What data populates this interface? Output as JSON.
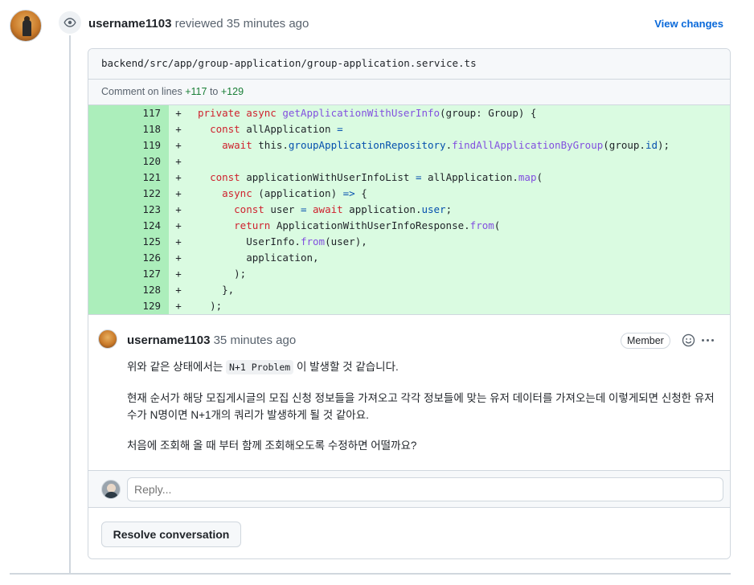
{
  "review": {
    "username": "username1103",
    "action": "reviewed",
    "time": "35 minutes ago",
    "view_changes_label": "View changes"
  },
  "file": {
    "path": "backend/src/app/group-application/group-application.service.ts",
    "lines_prefix": "Comment on lines",
    "line_start": "+117",
    "lines_to": "to",
    "line_end": "+129"
  },
  "diff": [
    {
      "num": "117",
      "marker": "+"
    },
    {
      "num": "118",
      "marker": "+"
    },
    {
      "num": "119",
      "marker": "+"
    },
    {
      "num": "120",
      "marker": "+"
    },
    {
      "num": "121",
      "marker": "+"
    },
    {
      "num": "122",
      "marker": "+"
    },
    {
      "num": "123",
      "marker": "+"
    },
    {
      "num": "124",
      "marker": "+"
    },
    {
      "num": "125",
      "marker": "+"
    },
    {
      "num": "126",
      "marker": "+"
    },
    {
      "num": "127",
      "marker": "+"
    },
    {
      "num": "128",
      "marker": "+"
    },
    {
      "num": "129",
      "marker": "+"
    }
  ],
  "code": {
    "l117": {
      "kw": "private async ",
      "fn": "getApplicationWithUserInfo",
      "rest": "(group: Group) {"
    },
    "l118": {
      "indent": "  ",
      "kw": "const ",
      "ident": "allApplication ",
      "op": "="
    },
    "l119": {
      "indent": "    ",
      "kw": "await ",
      "this": "this.",
      "prop": "groupApplicationRepository",
      "dot": ".",
      "fn": "findAllApplicationByGroup",
      "arg": "(group.",
      "prop2": "id",
      "end": ");"
    },
    "l121": {
      "indent": "  ",
      "kw": "const ",
      "ident": "applicationWithUserInfoList ",
      "op": "= ",
      "obj": "allApplication.",
      "fn": "map",
      "end": "("
    },
    "l122": {
      "indent": "    ",
      "kw": "async ",
      "param": "(application) ",
      "op": "=> ",
      "end": "{"
    },
    "l123": {
      "indent": "      ",
      "kw": "const ",
      "ident": "user ",
      "op": "= ",
      "kw2": "await ",
      "obj": "application.",
      "prop": "user",
      "end": ";"
    },
    "l124": {
      "indent": "      ",
      "kw": "return ",
      "obj": "ApplicationWithUserInfoResponse.",
      "fn": "from",
      "end": "("
    },
    "l125": {
      "indent": "        ",
      "obj": "UserInfo.",
      "fn": "from",
      "end": "(user),"
    },
    "l126": {
      "indent": "        ",
      "text": "application,"
    },
    "l127": {
      "indent": "      ",
      "text": ");"
    },
    "l128": {
      "indent": "    ",
      "text": "},"
    },
    "l129": {
      "indent": "  ",
      "text": ");"
    }
  },
  "comment": {
    "username": "username1103",
    "time": "35 minutes ago",
    "badge": "Member",
    "p1_before": "위와 같은 상태에서는 ",
    "p1_code": "N+1 Problem",
    "p1_after": " 이 발생할 것 같습니다.",
    "p2": "현재 순서가 해당 모집게시글의 모집 신청 정보들을 가져오고 각각 정보들에 맞는 유저 데이터를 가져오는데 이렇게되면 신청한 유저수가 N명이면 N+1개의 쿼리가 발생하게 될 것 같아요.",
    "p3": "처음에 조회해 올 때 부터 함께 조회해오도록 수정하면 어떨까요?"
  },
  "reply": {
    "placeholder": "Reply..."
  },
  "resolve": {
    "label": "Resolve conversation"
  }
}
